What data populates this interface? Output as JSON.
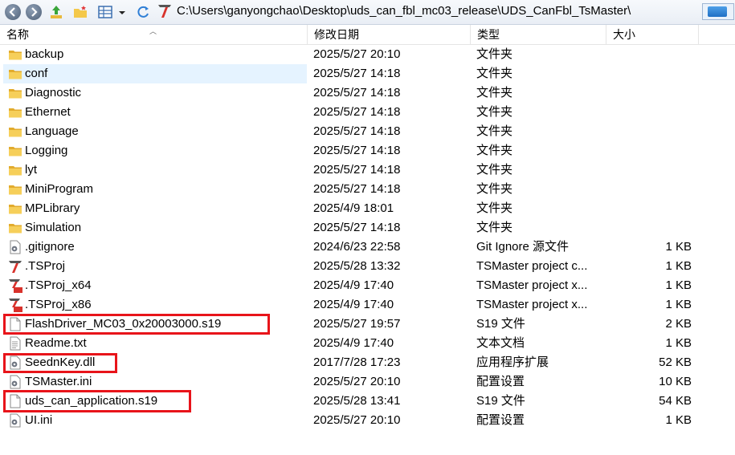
{
  "address": {
    "path": "C:\\Users\\ganyongchao\\Desktop\\uds_can_fbl_mc03_release\\UDS_CanFbl_TsMaster\\"
  },
  "columns": {
    "name": "名称",
    "date": "修改日期",
    "type": "类型",
    "size": "大小"
  },
  "files": [
    {
      "name": "backup",
      "date": "2025/5/27 20:10",
      "type": "文件夹",
      "size": "",
      "icon": "folder-icon"
    },
    {
      "name": "conf",
      "date": "2025/5/27 14:18",
      "type": "文件夹",
      "size": "",
      "icon": "folder-icon"
    },
    {
      "name": "Diagnostic",
      "date": "2025/5/27 14:18",
      "type": "文件夹",
      "size": "",
      "icon": "folder-icon"
    },
    {
      "name": "Ethernet",
      "date": "2025/5/27 14:18",
      "type": "文件夹",
      "size": "",
      "icon": "folder-icon"
    },
    {
      "name": "Language",
      "date": "2025/5/27 14:18",
      "type": "文件夹",
      "size": "",
      "icon": "folder-icon"
    },
    {
      "name": "Logging",
      "date": "2025/5/27 14:18",
      "type": "文件夹",
      "size": "",
      "icon": "folder-icon"
    },
    {
      "name": "lyt",
      "date": "2025/5/27 14:18",
      "type": "文件夹",
      "size": "",
      "icon": "folder-icon"
    },
    {
      "name": "MiniProgram",
      "date": "2025/5/27 14:18",
      "type": "文件夹",
      "size": "",
      "icon": "folder-icon"
    },
    {
      "name": "MPLibrary",
      "date": "2025/4/9 18:01",
      "type": "文件夹",
      "size": "",
      "icon": "folder-icon"
    },
    {
      "name": "Simulation",
      "date": "2025/5/27 14:18",
      "type": "文件夹",
      "size": "",
      "icon": "folder-icon"
    },
    {
      "name": ".gitignore",
      "date": "2024/6/23 22:58",
      "type": "Git Ignore 源文件",
      "size": "1 KB",
      "icon": "gear-file-icon"
    },
    {
      "name": ".TSProj",
      "date": "2025/5/28 13:32",
      "type": "TSMaster project c...",
      "size": "1 KB",
      "icon": "tsmaster-icon"
    },
    {
      "name": ".TSProj_x64",
      "date": "2025/4/9 17:40",
      "type": "TSMaster project x...",
      "size": "1 KB",
      "icon": "tsmaster-x64-icon"
    },
    {
      "name": ".TSProj_x86",
      "date": "2025/4/9 17:40",
      "type": "TSMaster project x...",
      "size": "1 KB",
      "icon": "tsmaster-x86-icon"
    },
    {
      "name": "FlashDriver_MC03_0x20003000.s19",
      "date": "2025/5/27 19:57",
      "type": "S19 文件",
      "size": "2 KB",
      "icon": "file-icon"
    },
    {
      "name": "Readme.txt",
      "date": "2025/4/9 17:40",
      "type": "文本文档",
      "size": "1 KB",
      "icon": "text-file-icon"
    },
    {
      "name": "SeednKey.dll",
      "date": "2017/7/28 17:23",
      "type": "应用程序扩展",
      "size": "52 KB",
      "icon": "gear-file-icon"
    },
    {
      "name": "TSMaster.ini",
      "date": "2025/5/27 20:10",
      "type": "配置设置",
      "size": "10 KB",
      "icon": "gear-file-icon"
    },
    {
      "name": "uds_can_application.s19",
      "date": "2025/5/28 13:41",
      "type": "S19 文件",
      "size": "54 KB",
      "icon": "file-icon"
    },
    {
      "name": "UI.ini",
      "date": "2025/5/27 20:10",
      "type": "配置设置",
      "size": "1 KB",
      "icon": "gear-file-icon"
    }
  ],
  "colors": {
    "highlight": "#e8141a",
    "selection": "#e5f3ff",
    "folder": "#f4c84a"
  }
}
